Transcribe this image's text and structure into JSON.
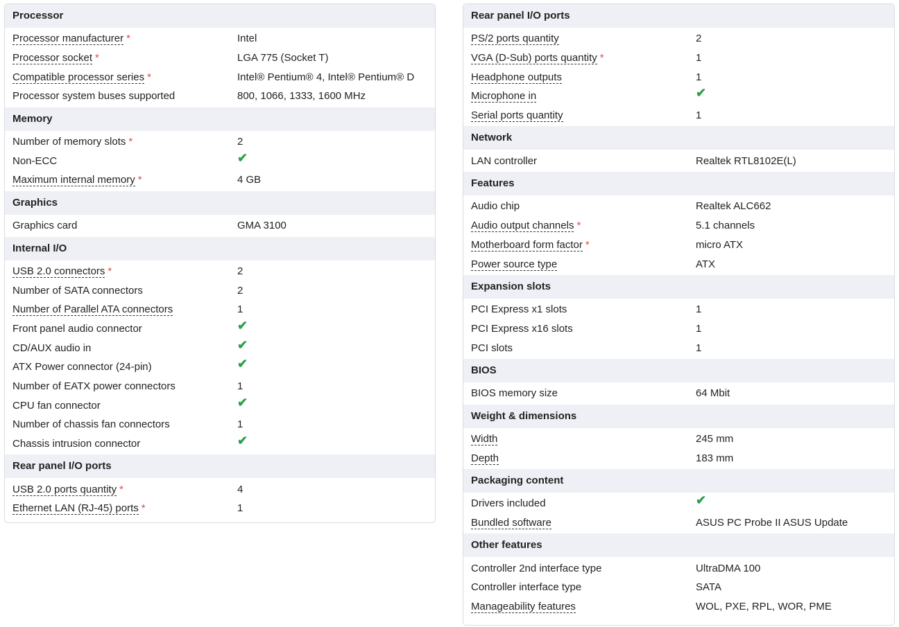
{
  "colors": {
    "section_bg": "#eef0f5",
    "check": "#2aa14a",
    "required_star": "#e04b4b",
    "border": "#d8dbe0"
  },
  "icons": {
    "check": "check-icon"
  },
  "left": [
    {
      "title": "Processor",
      "rows": [
        {
          "label": "Processor manufacturer",
          "value": "Intel",
          "underlined": true,
          "required": true
        },
        {
          "label": "Processor socket",
          "value": "LGA 775 (Socket T)",
          "underlined": true,
          "required": true
        },
        {
          "label": "Compatible processor series",
          "value": "Intel® Pentium® 4, Intel® Pentium® D",
          "underlined": true,
          "required": true
        },
        {
          "label": "Processor system buses supported",
          "value": "800, 1066, 1333, 1600 MHz",
          "underlined": false,
          "required": false
        }
      ]
    },
    {
      "title": "Memory",
      "rows": [
        {
          "label": "Number of memory slots",
          "value": "2",
          "underlined": false,
          "required": true
        },
        {
          "label": "Non-ECC",
          "value": "✔",
          "check": true,
          "underlined": false,
          "required": false
        },
        {
          "label": "Maximum internal memory",
          "value": "4 GB",
          "underlined": true,
          "required": true
        }
      ]
    },
    {
      "title": "Graphics",
      "rows": [
        {
          "label": "Graphics card",
          "value": "GMA 3100",
          "underlined": false,
          "required": false
        }
      ]
    },
    {
      "title": "Internal I/O",
      "rows": [
        {
          "label": "USB 2.0 connectors",
          "value": "2",
          "underlined": true,
          "required": true
        },
        {
          "label": "Number of SATA connectors",
          "value": "2",
          "underlined": false,
          "required": false
        },
        {
          "label": "Number of Parallel ATA connectors",
          "value": "1",
          "underlined": true,
          "required": false
        },
        {
          "label": "Front panel audio connector",
          "value": "✔",
          "check": true,
          "underlined": false,
          "required": false
        },
        {
          "label": "CD/AUX audio in",
          "value": "✔",
          "check": true,
          "underlined": false,
          "required": false
        },
        {
          "label": "ATX Power connector (24-pin)",
          "value": "✔",
          "check": true,
          "underlined": false,
          "required": false
        },
        {
          "label": "Number of EATX power connectors",
          "value": "1",
          "underlined": false,
          "required": false
        },
        {
          "label": "CPU fan connector",
          "value": "✔",
          "check": true,
          "underlined": false,
          "required": false
        },
        {
          "label": "Number of chassis fan connectors",
          "value": "1",
          "underlined": false,
          "required": false
        },
        {
          "label": "Chassis intrusion connector",
          "value": "✔",
          "check": true,
          "underlined": false,
          "required": false
        }
      ]
    },
    {
      "title": "Rear panel I/O ports",
      "rows": [
        {
          "label": "USB 2.0 ports quantity",
          "value": "4",
          "underlined": true,
          "required": true
        },
        {
          "label": "Ethernet LAN (RJ-45) ports",
          "value": "1",
          "underlined": true,
          "required": true
        }
      ]
    }
  ],
  "right": [
    {
      "title": "Rear panel I/O ports",
      "rows": [
        {
          "label": "PS/2 ports quantity",
          "value": "2",
          "underlined": true,
          "required": false
        },
        {
          "label": "VGA (D-Sub) ports quantity",
          "value": "1",
          "underlined": true,
          "required": true
        },
        {
          "label": "Headphone outputs",
          "value": "1",
          "underlined": true,
          "required": false
        },
        {
          "label": "Microphone in",
          "value": "✔",
          "check": true,
          "underlined": true,
          "required": false
        },
        {
          "label": "Serial ports quantity",
          "value": "1",
          "underlined": true,
          "required": false
        }
      ]
    },
    {
      "title": "Network",
      "rows": [
        {
          "label": "LAN controller",
          "value": "Realtek RTL8102E(L)",
          "underlined": false,
          "required": false
        }
      ]
    },
    {
      "title": "Features",
      "rows": [
        {
          "label": "Audio chip",
          "value": "Realtek ALC662",
          "underlined": false,
          "required": false
        },
        {
          "label": "Audio output channels",
          "value": "5.1 channels",
          "underlined": true,
          "required": true
        },
        {
          "label": "Motherboard form factor",
          "value": "micro ATX",
          "underlined": true,
          "required": true
        },
        {
          "label": "Power source type",
          "value": "ATX",
          "underlined": true,
          "required": false
        }
      ]
    },
    {
      "title": "Expansion slots",
      "rows": [
        {
          "label": "PCI Express x1 slots",
          "value": "1",
          "underlined": false,
          "required": false
        },
        {
          "label": "PCI Express x16 slots",
          "value": "1",
          "underlined": false,
          "required": false
        },
        {
          "label": "PCI slots",
          "value": "1",
          "underlined": false,
          "required": false
        }
      ]
    },
    {
      "title": "BIOS",
      "rows": [
        {
          "label": "BIOS memory size",
          "value": "64 Mbit",
          "underlined": false,
          "required": false
        }
      ]
    },
    {
      "title": "Weight & dimensions",
      "rows": [
        {
          "label": "Width",
          "value": "245 mm",
          "underlined": true,
          "required": false
        },
        {
          "label": "Depth",
          "value": "183 mm",
          "underlined": true,
          "required": false
        }
      ]
    },
    {
      "title": "Packaging content",
      "rows": [
        {
          "label": "Drivers included",
          "value": "✔",
          "check": true,
          "underlined": false,
          "required": false
        },
        {
          "label": "Bundled software",
          "value": "ASUS PC Probe II ASUS Update",
          "underlined": true,
          "required": false
        }
      ]
    },
    {
      "title": "Other features",
      "rows": [
        {
          "label": "Controller 2nd interface type",
          "value": "UltraDMA 100",
          "underlined": false,
          "required": false
        },
        {
          "label": "Controller interface type",
          "value": "SATA",
          "underlined": false,
          "required": false
        },
        {
          "label": "Manageability features",
          "value": "WOL, PXE, RPL, WOR, PME",
          "underlined": true,
          "required": false
        }
      ]
    }
  ]
}
